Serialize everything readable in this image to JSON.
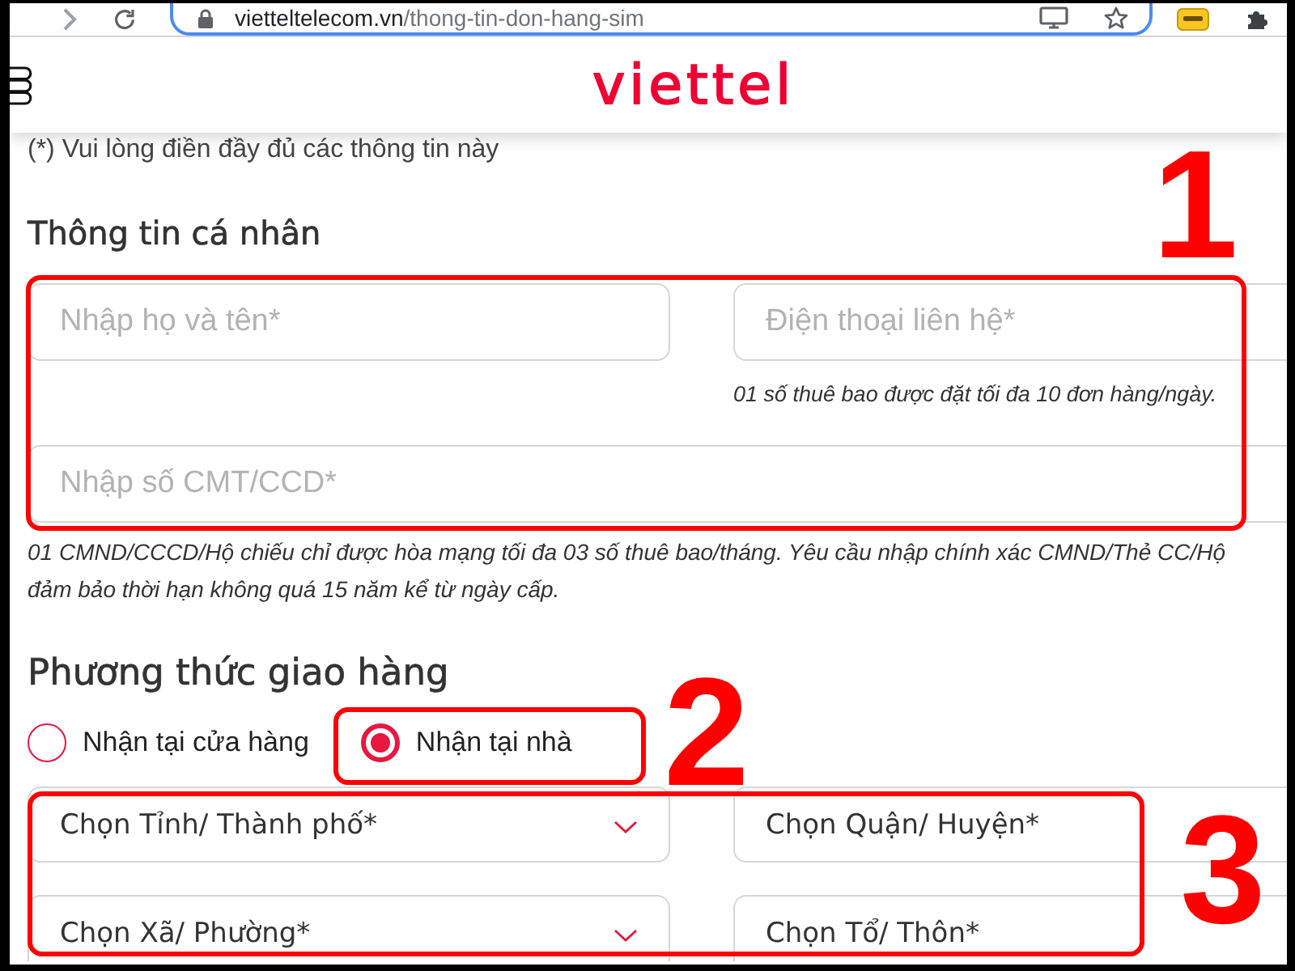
{
  "browser": {
    "url": {
      "host": "vietteltelecom.vn",
      "path": "/thong-tin-don-hang-sim"
    }
  },
  "header": {
    "logo": "viettel"
  },
  "required_note": "(*) Vui lòng điền đầy đủ các thông tin này",
  "personal_info": {
    "title": "Thông tin cá nhân",
    "name_field": {
      "placeholder": "Nhập họ và tên*"
    },
    "phone_field": {
      "placeholder": "Điện thoại liên hệ*",
      "hint": "01 số thuê bao được đặt tối đa 10 đơn hàng/ngày."
    },
    "id_field": {
      "placeholder": "Nhập số CMT/CCD*",
      "hint_lines": [
        "01 CMND/CCCD/Hộ chiếu chỉ được hòa mạng tối đa 03 số thuê bao/tháng. Yêu cầu nhập chính xác CMND/Thẻ CC/Hộ",
        "đảm bảo thời hạn không quá 15 năm kể từ ngày cấp."
      ]
    }
  },
  "delivery": {
    "title": "Phương thức giao hàng",
    "options": [
      {
        "label": "Nhận tại cửa hàng",
        "selected": false
      },
      {
        "label": "Nhận tại nhà",
        "selected": true
      }
    ],
    "address_selects": [
      {
        "label": "Chọn Tỉnh/ Thành phố*"
      },
      {
        "label": "Chọn Quận/ Huyện*"
      },
      {
        "label": "Chọn Xã/ Phường*"
      },
      {
        "label": "Chọn Tổ/ Thôn*"
      }
    ]
  },
  "annotations": [
    {
      "label": "1"
    },
    {
      "label": "2"
    },
    {
      "label": "3"
    }
  ]
}
